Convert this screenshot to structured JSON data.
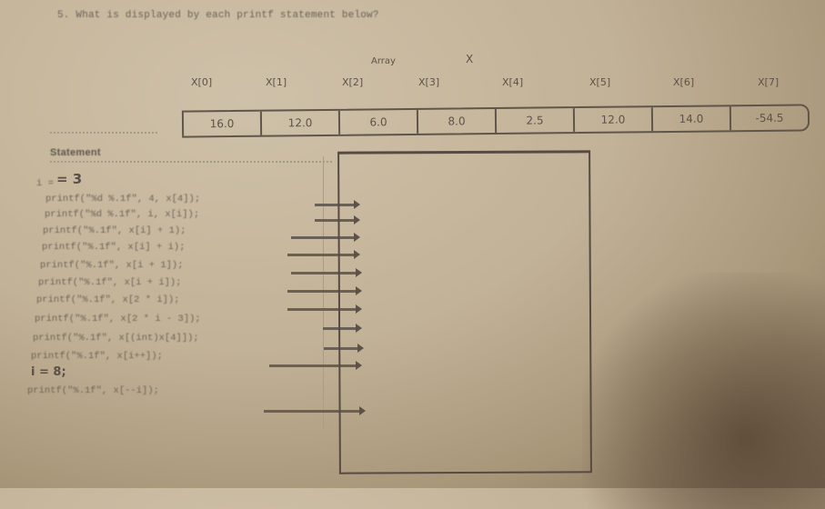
{
  "question": "5. What is displayed by each printf statement below?",
  "array": {
    "title": "Array",
    "name": "X",
    "indices": [
      "X[0]",
      "X[1]",
      "X[2]",
      "X[3]",
      "X[4]",
      "X[5]",
      "X[6]",
      "X[7]"
    ],
    "values": [
      "16.0",
      "12.0",
      "6.0",
      "8.0",
      "2.5",
      "12.0",
      "14.0",
      "-54.5"
    ]
  },
  "statement_header": "Statement",
  "handwritten": {
    "i_assign_1": "= 3",
    "i_assign_2": "i = 8;"
  },
  "statements": [
    "i =",
    "printf(\"%d %.1f\", 4, x[4]);",
    "printf(\"%d %.1f\", i, x[i]);",
    "printf(\"%.1f\", x[i] + 1);",
    "printf(\"%.1f\", x[i] + i);",
    "printf(\"%.1f\", x[i + 1]);",
    "printf(\"%.1f\", x[i + i]);",
    "printf(\"%.1f\", x[2 * i]);",
    "printf(\"%.1f\", x[2 * i - 3]);",
    "printf(\"%.1f\", x[(int)x[4]]);",
    "printf(\"%.1f\", x[i++]);",
    "printf(\"%.1f\", x[--i]);"
  ],
  "answers": []
}
